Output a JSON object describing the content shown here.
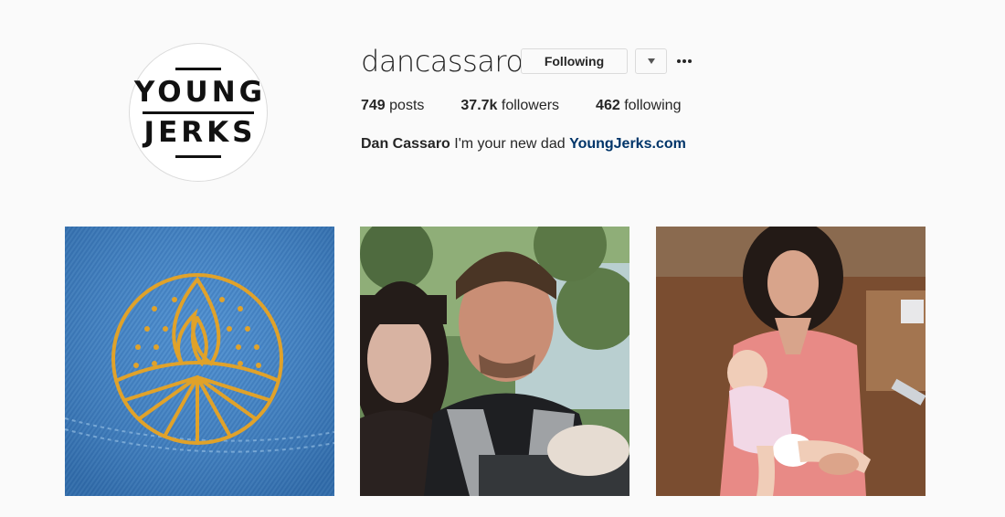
{
  "profile": {
    "username": "dancassaro",
    "avatar_text": [
      "YOUNG",
      "JERKS"
    ],
    "follow_button_label": "Following",
    "dropdown_icon": "caret-down-icon",
    "more_icon": "ellipsis-icon"
  },
  "stats": {
    "posts_count": "749",
    "posts_label": "posts",
    "followers_count": "37.7k",
    "followers_label": "followers",
    "following_count": "462",
    "following_label": "following"
  },
  "bio": {
    "full_name": "Dan Cassaro",
    "text": "I'm your new dad",
    "link": "YoungJerks.com"
  },
  "posts": [
    {
      "kind": "embroidered-flame-on-denim"
    },
    {
      "kind": "selfie-couple-with-baby-carrier"
    },
    {
      "kind": "woman-holding-baby-on-couch"
    }
  ],
  "colors": {
    "background": "#fafafa",
    "text": "#262626",
    "link": "#003569",
    "border": "#dbdbdb"
  }
}
